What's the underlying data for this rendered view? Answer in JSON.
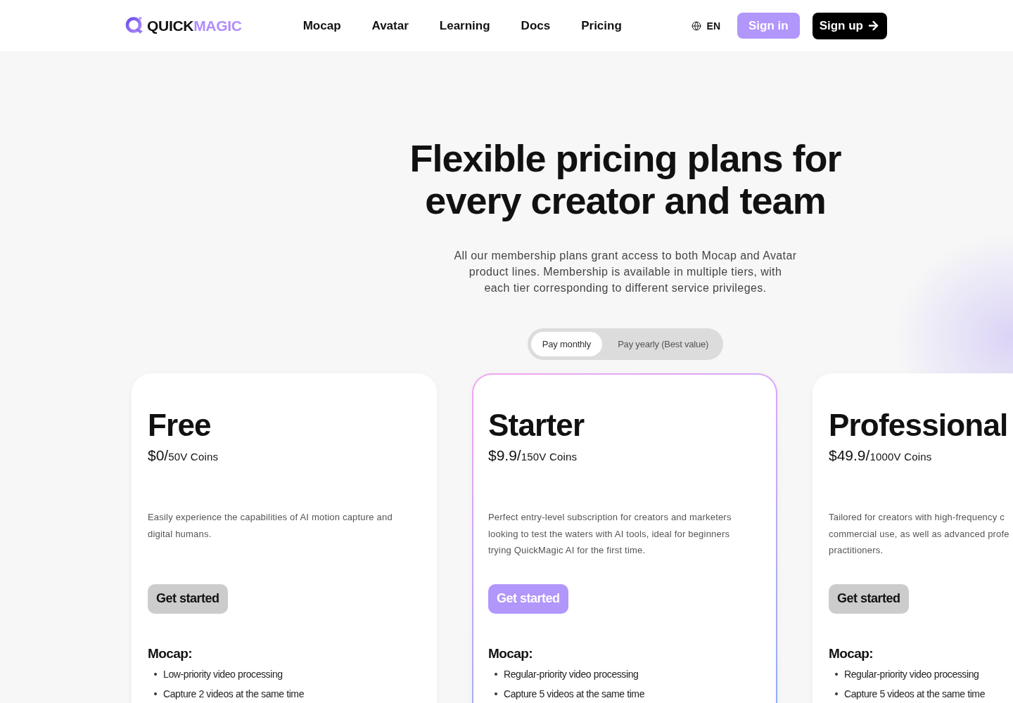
{
  "header": {
    "logo": {
      "primary": "QUICK",
      "accent": "MAGIC"
    },
    "nav": [
      "Mocap",
      "Avatar",
      "Learning",
      "Docs",
      "Pricing"
    ],
    "language": "EN",
    "sign_in": "Sign in",
    "sign_up": "Sign up"
  },
  "hero": {
    "title": "Flexible pricing plans for every creator and team",
    "subtitle": "All our membership plans grant access to both Mocap and Avatar\nproduct lines. Membership is available in multiple tiers, with\neach tier corresponding to different service privileges."
  },
  "billing_toggle": [
    {
      "label": "Pay monthly",
      "selected": true
    },
    {
      "label": "Pay yearly (Best value)",
      "selected": false
    }
  ],
  "plans": [
    {
      "name": "Free",
      "price": "$0/",
      "coins": "50V Coins",
      "description": "Easily experience the capabilities of AI motion capture and\ndigital humans.",
      "highlighted": false,
      "button": "Get started",
      "features": [
        {
          "title": "Mocap:",
          "items": [
            "Low-priority video processing",
            "Capture 2 videos at the same time"
          ]
        }
      ]
    },
    {
      "name": "Starter",
      "price": "$9.9/",
      "coins": "150V Coins",
      "description": "Perfect entry-level subscription for creators and marketers\nlooking to test the waters with AI tools, ideal for beginners\ntrying QuickMagic AI for the first time.",
      "highlighted": true,
      "button": "Get started",
      "features": [
        {
          "title": "Mocap:",
          "items": [
            "Regular-priority video processing",
            "Capture 5 videos at the same time"
          ]
        }
      ]
    },
    {
      "name": "Professional",
      "price": "$49.9/",
      "coins": "1000V Coins",
      "description": "Tailored for creators with high-frequency c\ncommercial use, as well as advanced profe\npractitioners.",
      "highlighted": false,
      "button": "Get started",
      "features": [
        {
          "title": "Mocap:",
          "items": [
            "Regular-priority video processing",
            "Capture 5 videos at the same time"
          ]
        }
      ]
    }
  ]
}
